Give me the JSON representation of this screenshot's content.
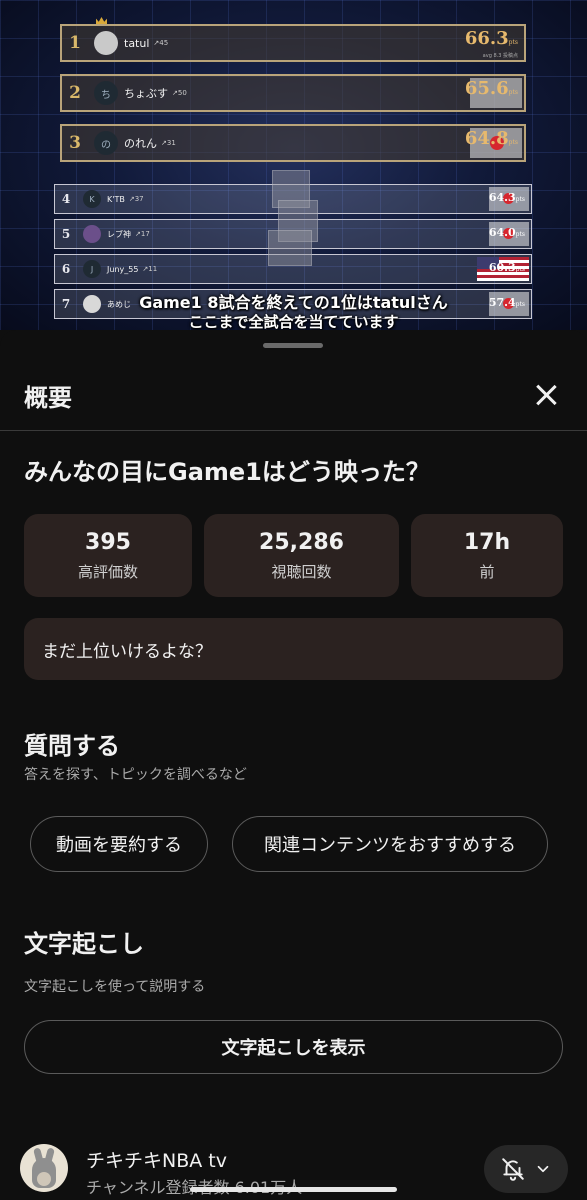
{
  "video": {
    "leaderboard": [
      {
        "rank": "1",
        "initial": "",
        "name": "tatul",
        "delta": "↗45",
        "score": "66.3",
        "unit": "pts",
        "avg": "avg 8.3 投稿点"
      },
      {
        "rank": "2",
        "initial": "ち",
        "name": "ちょぶす",
        "delta": "↗50",
        "score": "65.6",
        "unit": "pts"
      },
      {
        "rank": "3",
        "initial": "の",
        "name": "のれん",
        "delta": "↗31",
        "score": "64.8",
        "unit": "pts"
      },
      {
        "rank": "4",
        "initial": "K",
        "name": "K'TB",
        "delta": "↗37",
        "score": "64.3",
        "unit": "pts"
      },
      {
        "rank": "5",
        "initial": "",
        "name": "レブ神",
        "delta": "↗17",
        "score": "64.0",
        "unit": "pts"
      },
      {
        "rank": "6",
        "initial": "J",
        "name": "Juny_55",
        "delta": "↗11",
        "score": "60.3",
        "unit": "pts"
      },
      {
        "rank": "7",
        "initial": "",
        "name": "あめじ",
        "delta": "",
        "score": "57.4",
        "unit": "pts"
      }
    ],
    "caption_line1": "Game1 8試合を終えての1位はtatulさん",
    "caption_line2": "ここまで全試合を当てています"
  },
  "sheet": {
    "title": "概要",
    "close_icon": "close-icon",
    "video_title": "みんなの目にGame1はどう映った？",
    "stats": [
      {
        "value": "395",
        "label": "高評価数"
      },
      {
        "value": "25,286",
        "label": "視聴回数"
      },
      {
        "value": "17h",
        "label": "前"
      }
    ],
    "comment": "まだ上位いけるよな？",
    "ask": {
      "title": "質問する",
      "subtitle": "答えを探す、トピックを調べるなど",
      "chips": [
        "動画を要約する",
        "関連コンテンツをおすすめする"
      ]
    },
    "transcript": {
      "title": "文字起こし",
      "subtitle": "文字起こしを使って説明する",
      "button": "文字起こしを表示"
    },
    "channel": {
      "name": "チキチキNBA tv",
      "subscribers": "チャンネル登録者数 6.01万人",
      "bell_icon": "bell-off-icon",
      "dropdown_icon": "chevron-down-icon"
    }
  }
}
